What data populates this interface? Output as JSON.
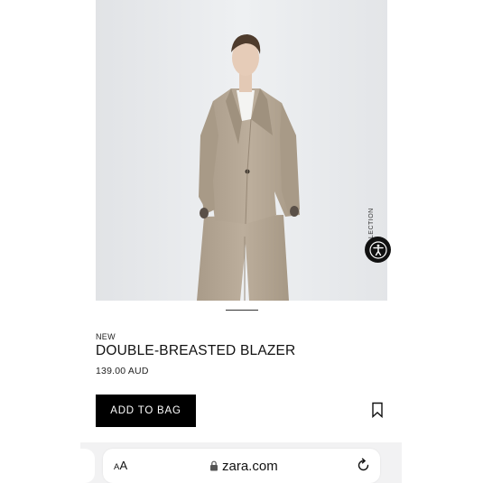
{
  "product": {
    "photo_label": "COLLECTION",
    "tag": "NEW",
    "name": "DOUBLE-BREASTED BLAZER",
    "price": "139.00 AUD",
    "add_to_bag_label": "ADD TO BAG"
  },
  "gallery": {
    "current_index": 1
  },
  "browser": {
    "text_size_label_small": "A",
    "text_size_label_large": "A",
    "domain": "zara.com",
    "lock_icon": "lock-icon",
    "reload_icon": "reload-icon"
  },
  "icons": {
    "accessibility": "accessibility-icon",
    "bookmark": "bookmark-icon"
  },
  "colors": {
    "button_bg": "#000000",
    "button_text": "#ffffff",
    "photo_bg": "#e8e9eb",
    "suit": "#b8aa98",
    "browser_bar": "#f2f2f3"
  }
}
